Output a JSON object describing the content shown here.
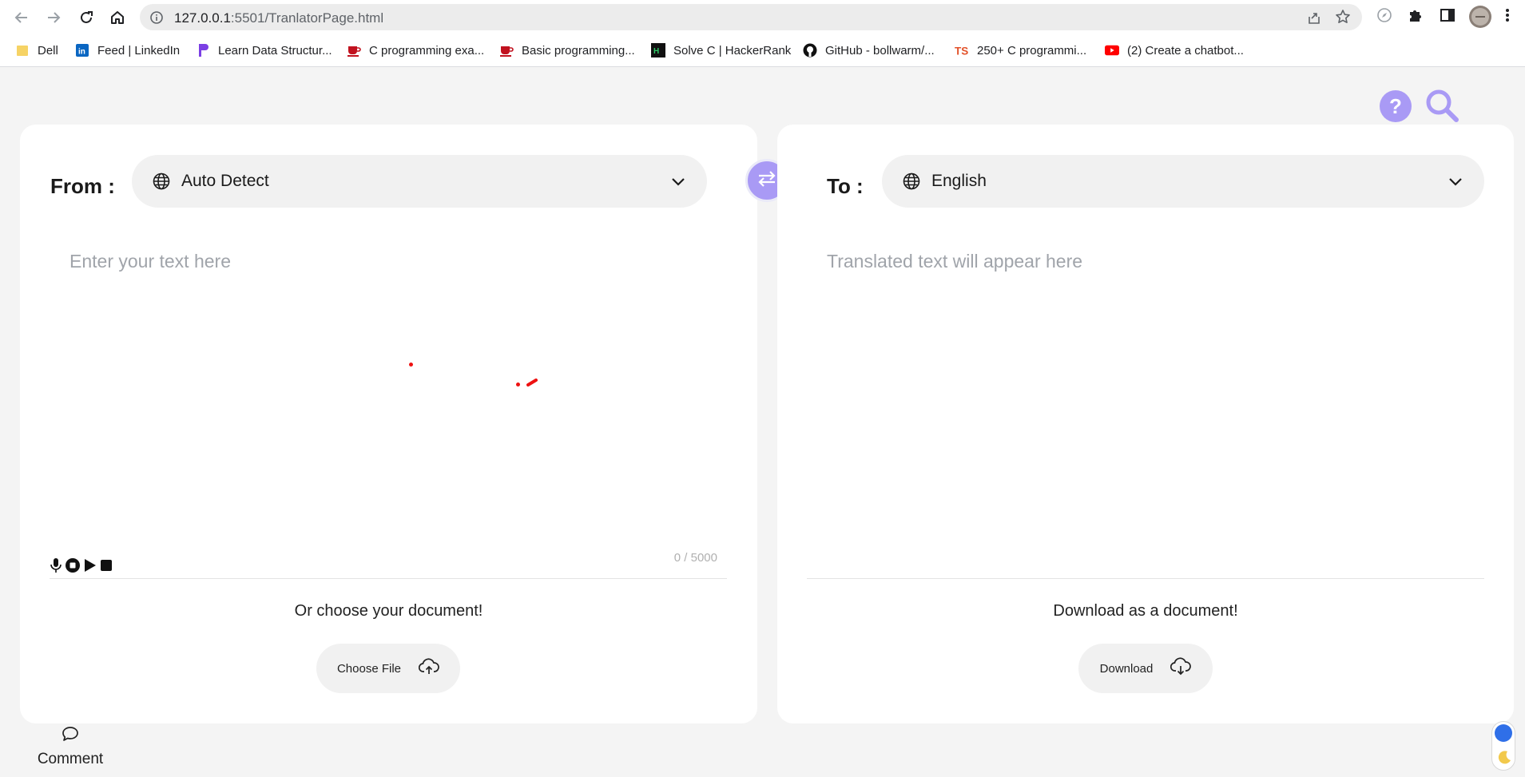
{
  "browser": {
    "url_host": "127.0.0.1",
    "url_rest": ":5501/TranlatorPage.html"
  },
  "bookmarks": [
    {
      "label": "Dell",
      "icon": "folder-icon"
    },
    {
      "label": "Feed | LinkedIn",
      "icon": "linkedin-icon"
    },
    {
      "label": "Learn Data Structur...",
      "icon": "p-logo-icon"
    },
    {
      "label": "C programming exa...",
      "icon": "cup-icon"
    },
    {
      "label": "Basic programming...",
      "icon": "cup-icon"
    },
    {
      "label": "Solve C | HackerRank",
      "icon": "hackerrank-icon"
    },
    {
      "label": "GitHub - bollwarm/...",
      "icon": "github-icon"
    },
    {
      "label": "250+ C programmi...",
      "icon": "ts-icon"
    },
    {
      "label": "(2) Create a chatbot...",
      "icon": "youtube-icon"
    }
  ],
  "translator": {
    "from_label": "From :",
    "from_language": "Auto Detect",
    "to_label": "To :",
    "to_language": "English",
    "input_placeholder": "Enter your text here",
    "output_placeholder": "Translated text will appear here",
    "char_count": "0 / 5000",
    "choose_doc_text": "Or choose your document!",
    "choose_file_label": "Choose File",
    "download_doc_text": "Download as a document!",
    "download_label": "Download"
  },
  "footer": {
    "comment_label": "Comment"
  },
  "colors": {
    "accent": "#a99af5",
    "toggle_knob": "#2f6fe8",
    "page_bg": "#f4f4f4"
  }
}
